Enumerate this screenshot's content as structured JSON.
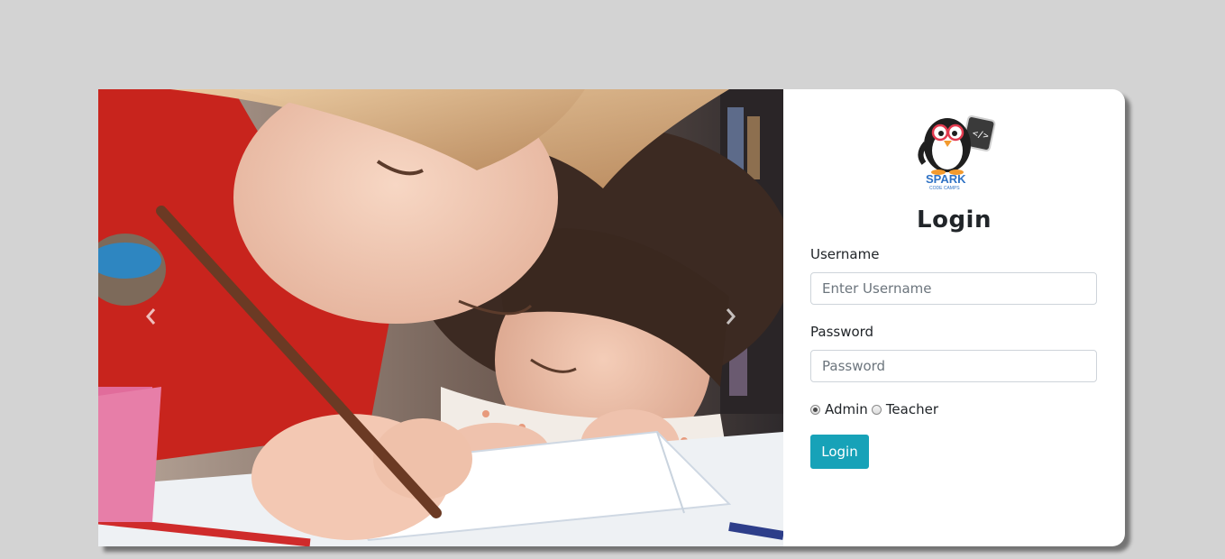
{
  "carousel": {
    "prev_icon": "chevron-left-icon",
    "next_icon": "chevron-right-icon"
  },
  "logo": {
    "icon": "penguin-mascot-logo",
    "text": "SPARK",
    "subtext": "CODE CAMPS"
  },
  "login": {
    "title": "Login",
    "username": {
      "label": "Username",
      "placeholder": "Enter Username",
      "value": ""
    },
    "password": {
      "label": "Password",
      "placeholder": "Password",
      "value": ""
    },
    "roles": [
      {
        "label": "Admin",
        "checked": true
      },
      {
        "label": "Teacher",
        "checked": false
      }
    ],
    "submit_label": "Login"
  },
  "colors": {
    "page_bg": "#d3d3d3",
    "accent": "#17a2b8",
    "text": "#212529"
  }
}
